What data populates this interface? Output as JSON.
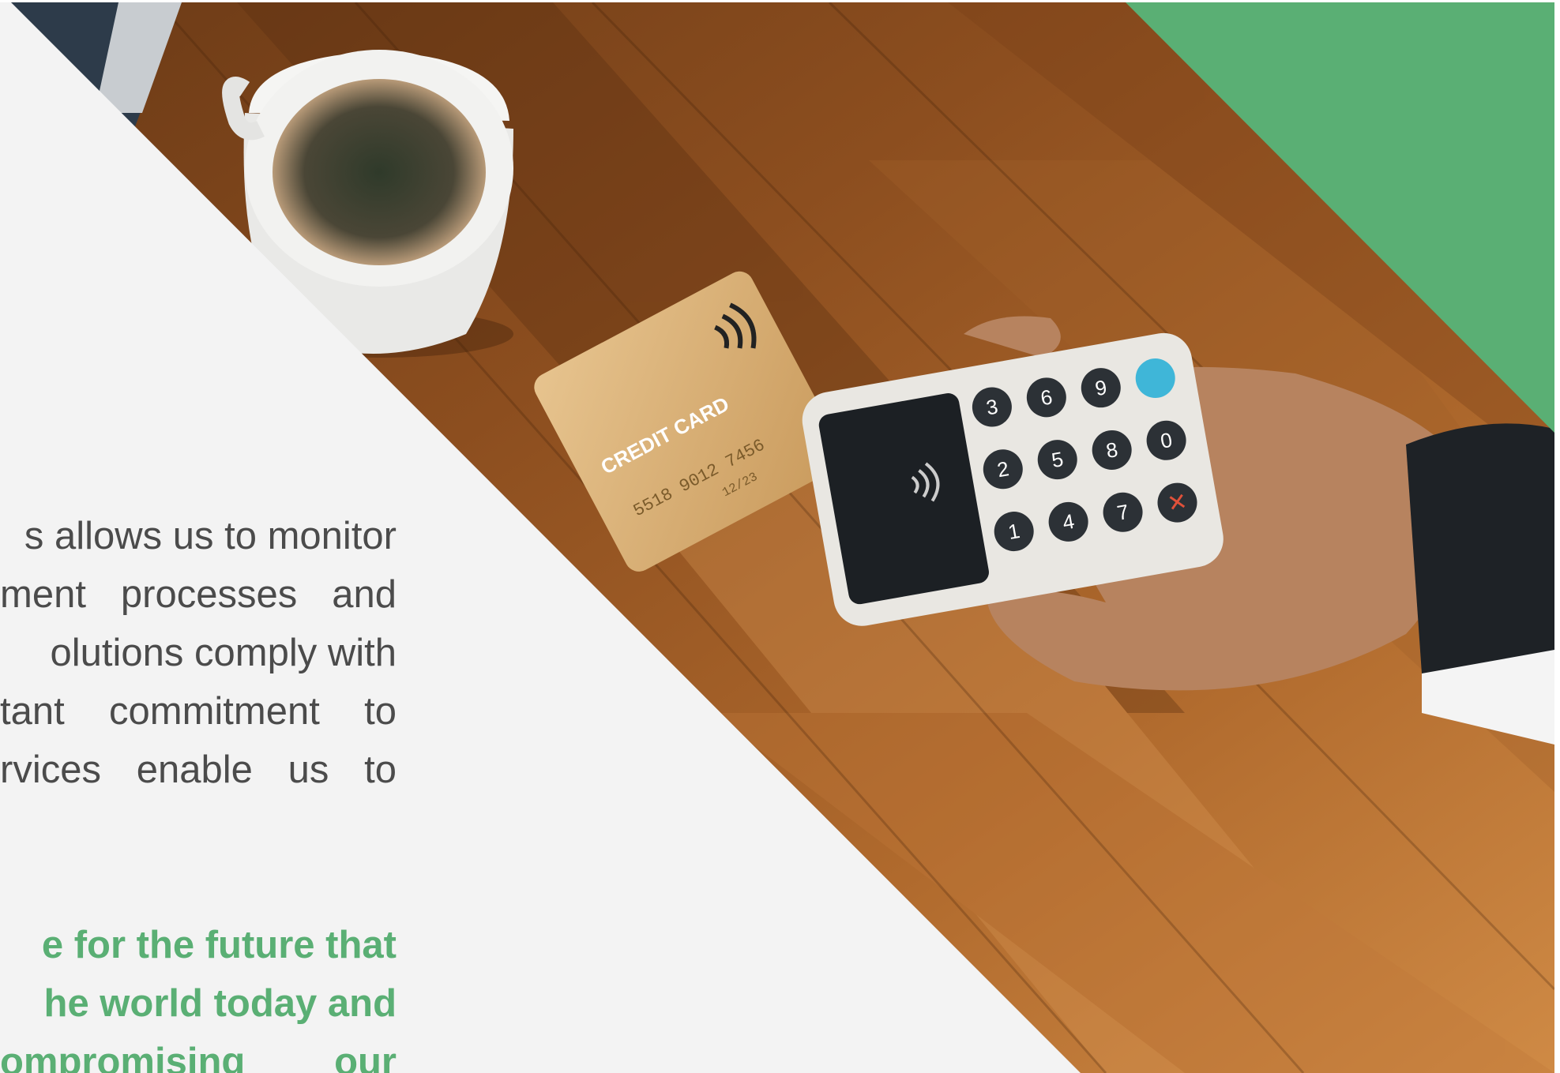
{
  "colors": {
    "accent_green": "#5aaf74",
    "panel_gray": "#f3f3f3",
    "body_text": "#4b4b4b",
    "wood": "#9a5a24"
  },
  "photo": {
    "description_icon": "payment-terminal-photo",
    "card_text": {
      "brand": "CREDIT CARD",
      "number": "5518 9012 7456",
      "expiry": "12/23"
    },
    "keypad": [
      "3",
      "6",
      "9",
      "2",
      "5",
      "8",
      "0",
      "1",
      "4",
      "7"
    ]
  },
  "body_lines": [
    "s allows us to monitor",
    "ment processes and",
    "olutions comply with",
    "tant commitment to",
    "rvices enable us to"
  ],
  "accent_lines": [
    "e for the future that",
    "he world today and",
    "ompromising our"
  ]
}
